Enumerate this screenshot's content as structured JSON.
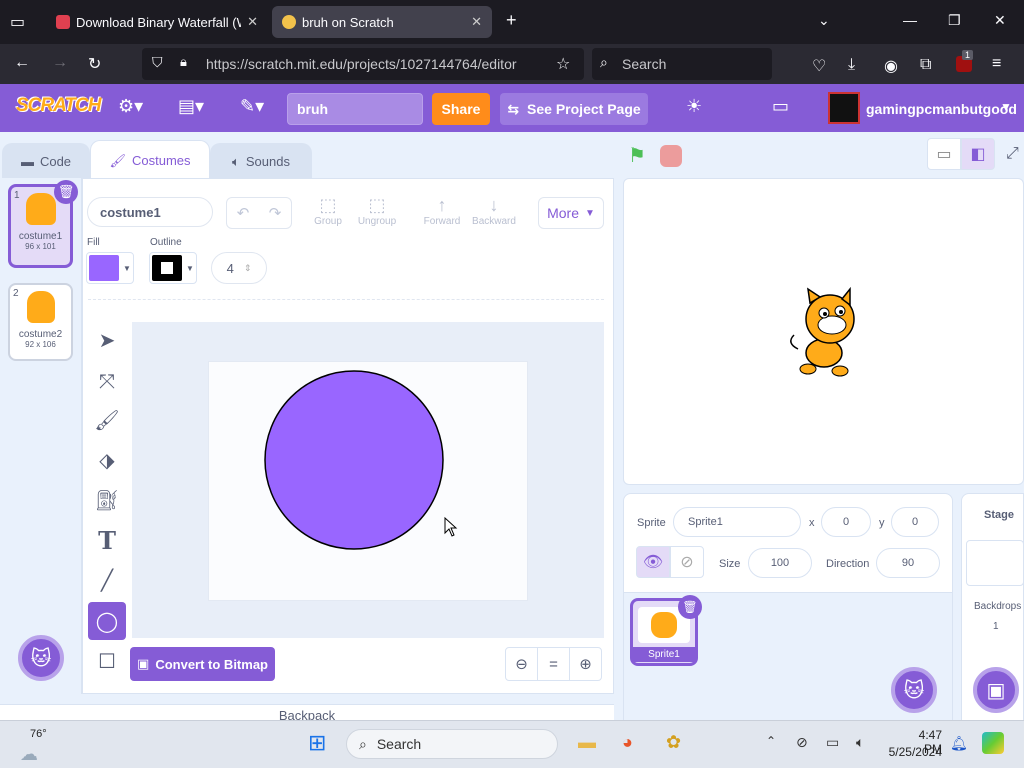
{
  "browser": {
    "tabs": [
      {
        "title": "Download Binary Waterfall (Wir",
        "active": false
      },
      {
        "title": "bruh on Scratch",
        "active": true
      }
    ],
    "url": "https://scratch.mit.edu/projects/1027144764/editor",
    "url_host": "scratch.mit.edu",
    "search_placeholder": "Search",
    "ext_badge": "1"
  },
  "scratch": {
    "logo": "SCRATCH",
    "project_title": "bruh",
    "share_label": "Share",
    "see_project_label": "See Project Page",
    "username": "gamingpcmanbutgood",
    "editor_tabs": [
      "Code",
      "Costumes",
      "Sounds"
    ],
    "costumes": [
      {
        "index": "1",
        "name": "costume1",
        "size": "96 x 101"
      },
      {
        "index": "2",
        "name": "costume2",
        "size": "92 x 106"
      }
    ],
    "paint": {
      "costume_name": "costume1",
      "fill_label": "Fill",
      "outline_label": "Outline",
      "outline_width": "4",
      "fill_color": "#9966ff",
      "outline_color": "#000000",
      "toolbar": [
        "Group",
        "Ungroup",
        "Forward",
        "Backward"
      ],
      "more_label": "More",
      "convert_label": "Convert to Bitmap",
      "zoom_reset": "="
    },
    "backpack_label": "Backpack",
    "sprite": {
      "label": "Sprite",
      "name": "Sprite1",
      "x_label": "x",
      "x": "0",
      "y_label": "y",
      "y": "0",
      "size_label": "Size",
      "size": "100",
      "direction_label": "Direction",
      "direction": "90",
      "tile_name": "Sprite1"
    },
    "stage_panel": {
      "label": "Stage",
      "backdrops_label": "Backdrops",
      "backdrops_count": "1"
    },
    "accent": "#855cd6"
  },
  "taskbar": {
    "weather": "76°",
    "search": "Search",
    "time": "4:47 PM",
    "date": "5/25/2024"
  }
}
